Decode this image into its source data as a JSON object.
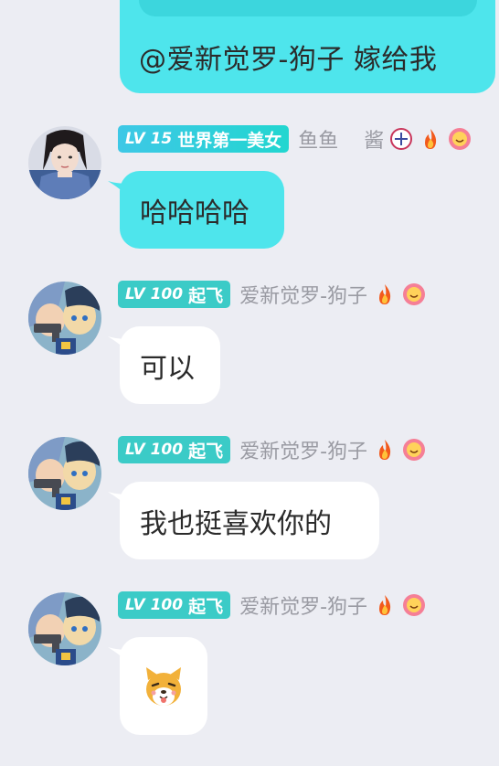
{
  "top_message": {
    "text": "@爱新觉罗-狗子 嫁给我"
  },
  "messages": [
    {
      "badge_level": "LV 15",
      "badge_title": "世界第一美女",
      "nickname": "鱼鱼",
      "nickname_extra": "酱",
      "text": "哈哈哈哈",
      "bubble_color": "#4EE5EC",
      "avatar": "girl-avatar"
    },
    {
      "badge_level": "LV 100",
      "badge_title": "起飞",
      "nickname": "爱新觉罗-狗子",
      "text": "可以",
      "bubble_color": "#FFFFFF",
      "avatar": "cartoon-avatar"
    },
    {
      "badge_level": "LV 100",
      "badge_title": "起飞",
      "nickname": "爱新觉罗-狗子",
      "text": "我也挺喜欢你的",
      "bubble_color": "#FFFFFF",
      "avatar": "cartoon-avatar"
    },
    {
      "badge_level": "LV 100",
      "badge_title": "起飞",
      "nickname": "爱新觉罗-狗子",
      "text": "",
      "sticker": "dog-sticker",
      "bubble_color": "#FFFFFF",
      "avatar": "cartoon-avatar"
    }
  ],
  "colors": {
    "background": "#ECEDF3",
    "accent_bubble": "#4EE5EC",
    "badge": "#3BCBC7",
    "nickname": "#9A9BA3"
  }
}
